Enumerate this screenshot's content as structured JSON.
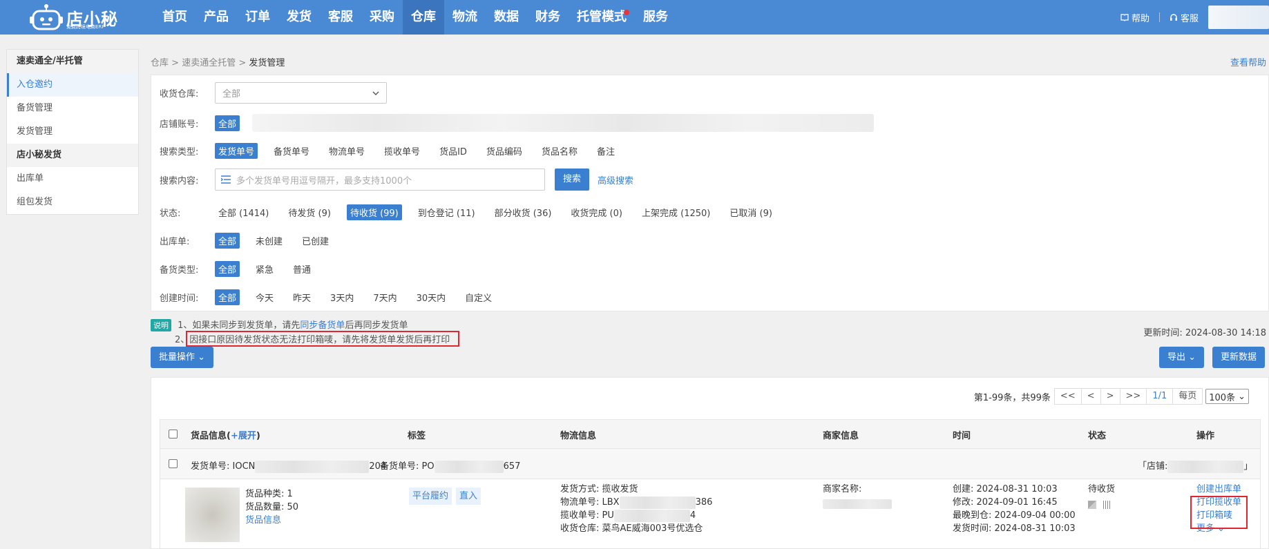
{
  "colors": {
    "primary": "#3b7fd0",
    "topbar": "#4a8ad4",
    "highlight_border": "#e0262e",
    "tip_badge": "#21a8a4"
  },
  "logo": {
    "title": "店小秘",
    "subtitle": "免费跨境电商ERP"
  },
  "nav": [
    "首页",
    "产品",
    "订单",
    "发货",
    "客服",
    "采购",
    "仓库",
    "物流",
    "数据",
    "财务",
    "托管模式",
    "服务"
  ],
  "nav_active": "仓库",
  "top_right": {
    "help": "帮助",
    "service": "客服"
  },
  "sidebar": {
    "groups": [
      {
        "title": "速卖通全/半托管",
        "items": [
          "入仓邀约",
          "备货管理",
          "发货管理"
        ]
      },
      {
        "title": "店小秘发货",
        "items": [
          "出库单",
          "组包发货"
        ]
      }
    ],
    "active_item": "入仓邀约"
  },
  "breadcrumb": {
    "items": [
      "仓库",
      "速卖通全托管"
    ],
    "current": "发货管理",
    "sep": ">"
  },
  "help_link": "查看帮助",
  "filters": {
    "warehouse": {
      "label": "收货仓库:",
      "value": "全部"
    },
    "store": {
      "label": "店铺账号:",
      "value": "全部"
    },
    "search_type": {
      "label": "搜索类型:",
      "options": [
        "发货单号",
        "备货单号",
        "物流单号",
        "揽收单号",
        "货品ID",
        "货品编码",
        "货品名称",
        "备注"
      ],
      "selected": 0
    },
    "search_content": {
      "label": "搜索内容:",
      "placeholder": "多个发货单号用逗号隔开，最多支持1000个",
      "button": "搜索",
      "advanced": "高级搜索"
    },
    "status": {
      "label": "状态:",
      "options": [
        "全部 (1414)",
        "待发货 (9)",
        "待收货 (99)",
        "到仓登记 (11)",
        "部分收货 (36)",
        "收货完成 (0)",
        "上架完成 (1250)",
        "已取消 (9)"
      ],
      "selected": 2
    },
    "outbound": {
      "label": "出库单:",
      "options": [
        "全部",
        "未创建",
        "已创建"
      ],
      "selected": 0
    },
    "stock_type": {
      "label": "备货类型:",
      "options": [
        "全部",
        "紧急",
        "普通"
      ],
      "selected": 0
    },
    "created": {
      "label": "创建时间:",
      "options": [
        "全部",
        "今天",
        "昨天",
        "3天内",
        "7天内",
        "30天内",
        "自定义"
      ],
      "selected": 0
    }
  },
  "notes": {
    "badge": "说明",
    "line1_prefix": "1、如果未同步到发货单，请先",
    "line1_link": "同步备货单",
    "line1_suffix": "后再同步发货单",
    "line2_num": "2、",
    "line2": "因接口原因待发货状态无法打印箱唛，请先将发货单发货后再打印"
  },
  "update_time": "更新时间: 2024-08-30 14:18",
  "buttons": {
    "batch": "批量操作",
    "export": "导出",
    "refresh": "更新数据"
  },
  "pager": {
    "summary": "第1-99条，共99条",
    "first": "<<",
    "prev": "<",
    "next": ">",
    "last": ">>",
    "page": "1/1",
    "per_page_label": "每页",
    "per_page": "100条"
  },
  "table": {
    "headers": {
      "goods": "货品信息(",
      "expand": "+展开",
      "goods_close": ")",
      "tags": "标签",
      "logistics": "物流信息",
      "merchant": "商家信息",
      "time": "时间",
      "status": "状态",
      "ops": "操作"
    },
    "group_row": {
      "ship_label": "发货单号: IOCN",
      "ship_tail": "204",
      "stock_label": "备货单号: PO",
      "stock_tail": "657",
      "store_label": "「店铺:",
      "store_close": "」"
    },
    "row": {
      "kinds": "货品种类: 1",
      "qty": "货品数量: 50",
      "goods_link": "货品信息",
      "tags": [
        "平台履约",
        "直入"
      ],
      "ship_method": "发货方式: 揽收发货",
      "logistics_no_label": "物流单号: LBX",
      "logistics_no_tail": "386",
      "pickup_no_label": "揽收单号: PU",
      "pickup_no_tail": "4",
      "warehouse": "收货仓库: 菜鸟AE威海003号优选仓",
      "merchant_label": "商家名称:",
      "created": "创建: 2024-08-31 10:03",
      "modified": "修改: 2024-09-01 16:45",
      "latest_arrival": "最晚到仓: 2024-09-04 00:00",
      "shipped": "发货时间: 2024-08-31 10:03",
      "status": "待收货",
      "actions": [
        "创建出库单",
        "打印揽收单",
        "打印箱唛",
        "更多"
      ]
    }
  }
}
